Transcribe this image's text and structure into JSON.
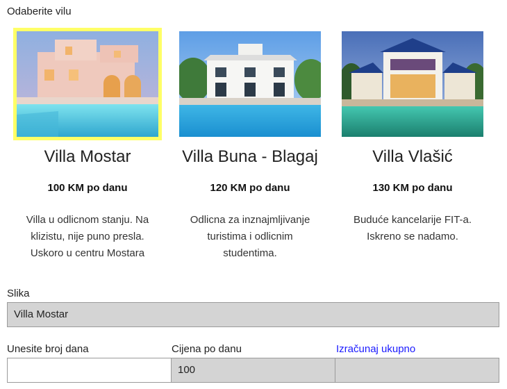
{
  "header": {
    "title": "Odaberite vilu"
  },
  "villas": [
    {
      "name": "Villa Mostar",
      "price": "100 KM po danu",
      "description": "Villa u odlicnom stanju. Na klizistu, nije puno presla. Uskoro u centru Mostara",
      "selected": true
    },
    {
      "name": "Villa Buna - Blagaj",
      "price": "120 KM po danu",
      "description": "Odlicna za inznajmljivanje turistima i odlicnim studentima.",
      "selected": false
    },
    {
      "name": "Villa Vlašić",
      "price": "130 KM po danu",
      "description": "Buduće kancelarije FIT-a. Iskreno se nadamo.",
      "selected": false
    }
  ],
  "form": {
    "image_label": "Slika",
    "image_value": "Villa Mostar",
    "days_label": "Unesite broj dana",
    "days_value": "",
    "price_label": "Cijena po danu",
    "price_value": "100",
    "calc_link": "Izračunaj ukupno",
    "total_value": ""
  },
  "colors": {
    "selected_border": "#ffff66",
    "link": "#1a1aff",
    "readonly_bg": "#d4d4d4"
  }
}
